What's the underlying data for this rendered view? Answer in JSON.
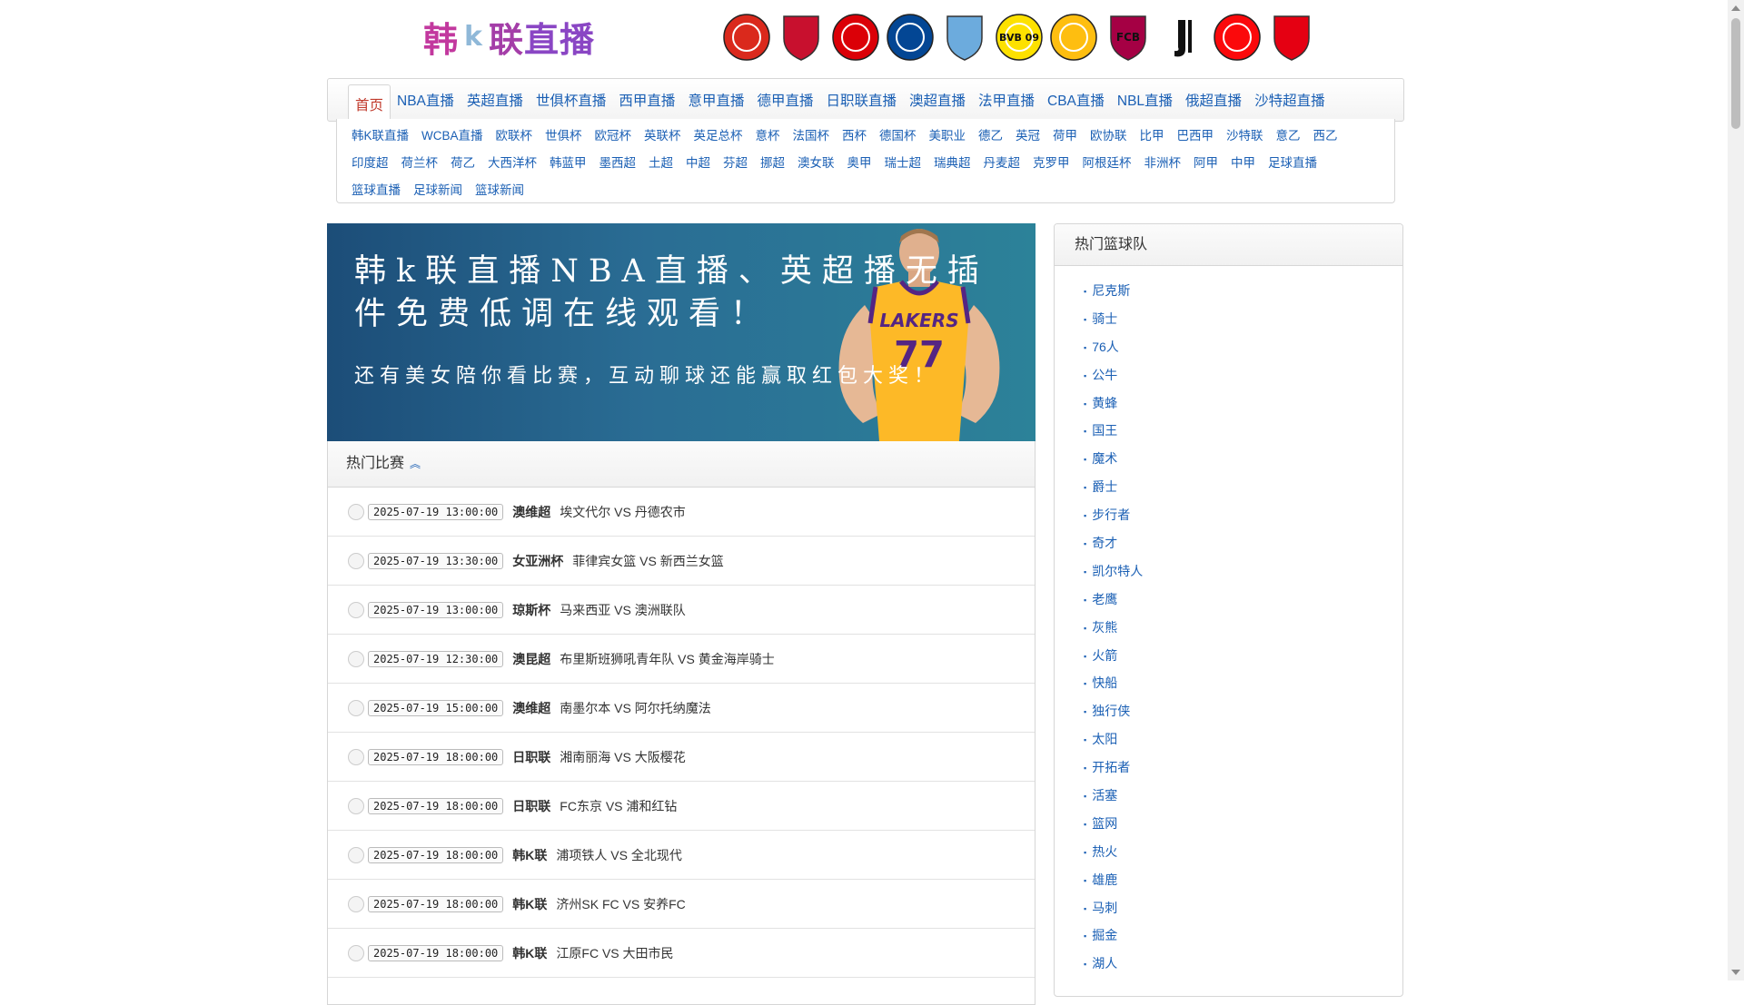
{
  "logo": {
    "part1": "韩",
    "part2": "k",
    "part3": "联",
    "part4": "直播"
  },
  "team_logos": [
    {
      "icon": "manchester-united-icon",
      "color": "#da291c",
      "label": ""
    },
    {
      "icon": "liverpool-icon",
      "color": "#c8102e",
      "label": ""
    },
    {
      "icon": "arsenal-icon",
      "color": "#db0007",
      "label": ""
    },
    {
      "icon": "chelsea-icon",
      "color": "#034694",
      "label": ""
    },
    {
      "icon": "manchester-city-icon",
      "color": "#6cabdd",
      "label": ""
    },
    {
      "icon": "dortmund-icon",
      "color": "#fde100",
      "label": "BVB 09"
    },
    {
      "icon": "real-madrid-icon",
      "color": "#febe10",
      "label": ""
    },
    {
      "icon": "barcelona-icon",
      "color": "#a50044",
      "label": "FCB"
    },
    {
      "icon": "juventus-icon",
      "color": "#000000",
      "label": ""
    },
    {
      "icon": "ac-milan-icon",
      "color": "#fb090b",
      "label": ""
    },
    {
      "icon": "guangzhou-icon",
      "color": "#e50012",
      "label": ""
    }
  ],
  "nav": {
    "main": [
      "首页",
      "NBA直播",
      "英超直播",
      "世俱杯直播",
      "西甲直播",
      "意甲直播",
      "德甲直播",
      "日职联直播",
      "澳超直播",
      "法甲直播",
      "CBA直播",
      "NBL直播",
      "俄超直播",
      "沙特超直播"
    ],
    "sub": [
      "韩K联直播",
      "WCBA直播",
      "欧联杯",
      "世俱杯",
      "欧冠杯",
      "英联杯",
      "英足总杯",
      "意杯",
      "法国杯",
      "西杯",
      "德国杯",
      "美职业",
      "德乙",
      "英冠",
      "荷甲",
      "欧协联",
      "比甲",
      "巴西甲",
      "沙特联",
      "意乙",
      "西乙",
      "印度超",
      "荷兰杯",
      "荷乙",
      "大西洋杯",
      "韩蓝甲",
      "墨西超",
      "土超",
      "中超",
      "芬超",
      "挪超",
      "澳女联",
      "奥甲",
      "瑞士超",
      "瑞典超",
      "丹麦超",
      "克罗甲",
      "阿根廷杯",
      "非洲杯",
      "阿甲",
      "中甲",
      "足球直播",
      "篮球直播",
      "足球新闻",
      "篮球新闻"
    ]
  },
  "banner": {
    "title": "韩k联直播NBA直播、英超播无插件免费低调在线观看！",
    "subtitle": "还有美女陪你看比赛，互动聊球还能赢取红包大奖！",
    "jersey_text": "LAKERS",
    "jersey_number": "77"
  },
  "hot_matches": {
    "title": "热门比赛",
    "rows": [
      {
        "time": "2025-07-19 13:00:00",
        "league": "澳维超",
        "teams": "埃文代尔 VS 丹德农市"
      },
      {
        "time": "2025-07-19 13:30:00",
        "league": "女亚洲杯",
        "teams": "菲律宾女篮 VS 新西兰女篮"
      },
      {
        "time": "2025-07-19 13:00:00",
        "league": "琼斯杯",
        "teams": "马来西亚 VS 澳洲联队"
      },
      {
        "time": "2025-07-19 12:30:00",
        "league": "澳昆超",
        "teams": "布里斯班狮吼青年队 VS 黄金海岸骑士"
      },
      {
        "time": "2025-07-19 15:00:00",
        "league": "澳维超",
        "teams": "南墨尔本 VS 阿尔托纳魔法"
      },
      {
        "time": "2025-07-19 18:00:00",
        "league": "日职联",
        "teams": "湘南丽海 VS 大阪樱花"
      },
      {
        "time": "2025-07-19 18:00:00",
        "league": "日职联",
        "teams": "FC东京 VS 浦和红钻"
      },
      {
        "time": "2025-07-19 18:00:00",
        "league": "韩K联",
        "teams": "浦项铁人 VS 全北现代"
      },
      {
        "time": "2025-07-19 18:00:00",
        "league": "韩K联",
        "teams": "济州SK FC VS 安养FC"
      },
      {
        "time": "2025-07-19 18:00:00",
        "league": "韩K联",
        "teams": "江原FC VS 大田市民"
      }
    ]
  },
  "hot_teams": {
    "title": "热门篮球队",
    "items": [
      "尼克斯",
      "骑士",
      "76人",
      "公牛",
      "黄蜂",
      "国王",
      "魔术",
      "爵士",
      "步行者",
      "奇才",
      "凯尔特人",
      "老鹰",
      "灰熊",
      "火箭",
      "快船",
      "独行侠",
      "太阳",
      "开拓者",
      "活塞",
      "篮网",
      "热火",
      "雄鹿",
      "马刺",
      "掘金",
      "湖人"
    ]
  }
}
